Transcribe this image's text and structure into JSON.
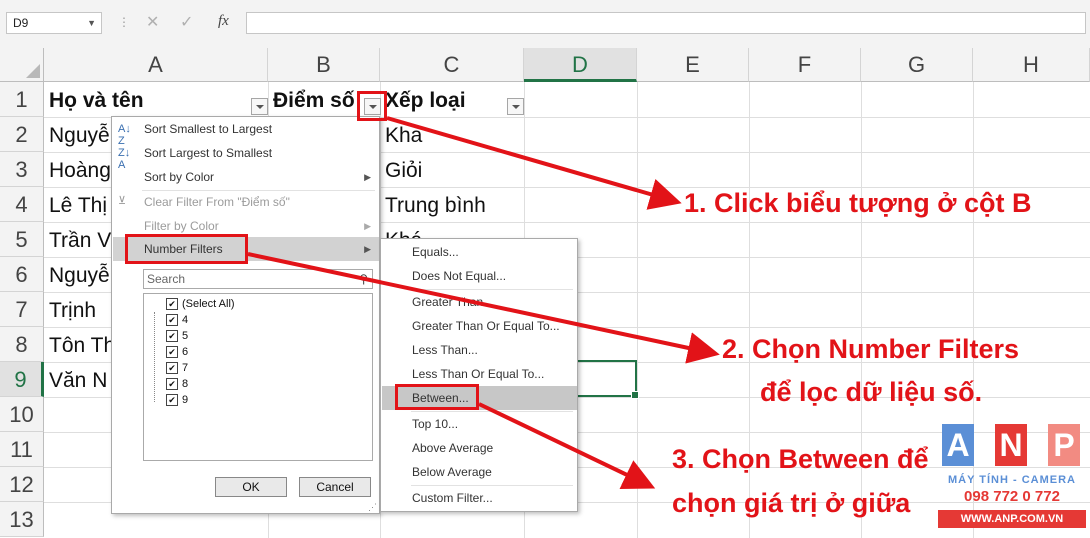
{
  "formula_bar": {
    "name_box": "D9",
    "fx": "fx",
    "cancel": "✕",
    "enter": "✓"
  },
  "columns": [
    "A",
    "B",
    "C",
    "D",
    "E",
    "F",
    "G",
    "H"
  ],
  "selected_column": "D",
  "rows": [
    "1",
    "2",
    "3",
    "4",
    "5",
    "6",
    "7",
    "8",
    "9",
    "10",
    "11",
    "12",
    "13"
  ],
  "selected_row": "9",
  "header": {
    "a": "Họ và tên",
    "b": "Điểm số",
    "c": "Xếp loại"
  },
  "col_a": [
    "Nguyễ",
    "Hoàng",
    "Lê Thị",
    "Trần V",
    "Nguyễ",
    "Trịnh",
    "Tôn Th",
    "Văn N"
  ],
  "col_c": [
    "Kha",
    "Giỏi",
    "Trung bình",
    "Khá"
  ],
  "filter_menu": {
    "sort_asc": "Sort Smallest to Largest",
    "sort_desc": "Sort Largest to Smallest",
    "sort_color": "Sort by Color",
    "clear_filter": "Clear Filter From \"Điểm số\"",
    "filter_color": "Filter by Color",
    "number_filters": "Number Filters",
    "search_placeholder": "Search",
    "checklist": [
      "(Select All)",
      "4",
      "5",
      "6",
      "7",
      "8",
      "9"
    ],
    "ok": "OK",
    "cancel": "Cancel"
  },
  "number_filters_submenu": [
    "Equals...",
    "Does Not Equal...",
    "Greater Than...",
    "Greater Than Or Equal To...",
    "Less Than...",
    "Less Than Or Equal To...",
    "Between...",
    "Top 10...",
    "Above Average",
    "Below Average",
    "Custom Filter..."
  ],
  "annotations": {
    "step1": "1. Click biểu tượng ở cột B",
    "step2_line1": "2. Chọn Number Filters",
    "step2_line2": "để lọc dữ liệu số.",
    "step3_line1": "3. Chọn Between để",
    "step3_line2": "chọn giá trị ở giữa",
    "annotation_color": "#e21318"
  },
  "logo": {
    "letters": [
      "A",
      "N",
      "P"
    ],
    "tagline": "MÁY TÍNH - CAMERA",
    "phone": "098 772 0 772",
    "website": "WWW.ANP.COM.VN",
    "colors": [
      "#5b8fd6",
      "#e53935",
      "#f28b82"
    ]
  }
}
